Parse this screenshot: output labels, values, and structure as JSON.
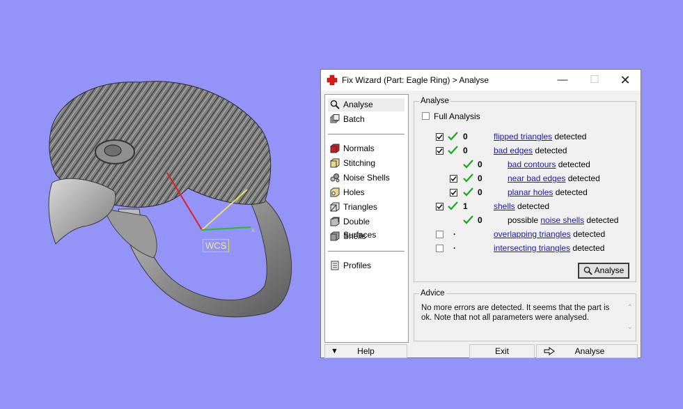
{
  "viewport": {
    "wcs_label": "WCS",
    "axis_x_label": "x",
    "background": "#9393f8"
  },
  "dialog": {
    "title": "Fix Wizard (Part: Eagle Ring) > Analyse",
    "title_icon": "red-cross-icon",
    "window_buttons": [
      "minimize",
      "maximize",
      "close"
    ]
  },
  "nav": {
    "top_items": [
      {
        "label": "Analyse",
        "icon": "magnifier-icon",
        "selected": true
      },
      {
        "label": "Batch",
        "icon": "batch-icon"
      }
    ],
    "tool_items": [
      {
        "label": "Normals",
        "icon": "normals-icon"
      },
      {
        "label": "Stitching",
        "icon": "stitching-icon"
      },
      {
        "label": "Noise Shells",
        "icon": "noise-shells-icon"
      },
      {
        "label": "Holes",
        "icon": "holes-icon"
      },
      {
        "label": "Triangles",
        "icon": "triangles-icon"
      },
      {
        "label": "Double Surfaces",
        "icon": "double-surfaces-icon"
      },
      {
        "label": "Shells",
        "icon": "shells-icon"
      }
    ],
    "bottom_items": [
      {
        "label": "Profiles",
        "icon": "profiles-icon"
      }
    ]
  },
  "analyse": {
    "group_title": "Analyse",
    "full_analysis_label": "Full Analysis",
    "full_analysis_checked": false,
    "rows": [
      {
        "checked": true,
        "ok": true,
        "value": "0",
        "link": "flipped triangles",
        "pre": "",
        "suffix": " detected"
      },
      {
        "checked": true,
        "ok": true,
        "value": "0",
        "link": "bad edges",
        "pre": "",
        "suffix": " detected"
      },
      {
        "checked": null,
        "ok": true,
        "value": "0",
        "link": "bad contours",
        "pre": "",
        "suffix": " detected"
      },
      {
        "checked": true,
        "ok": true,
        "value": "0",
        "link": "near bad edges",
        "pre": "",
        "suffix": " detected"
      },
      {
        "checked": true,
        "ok": true,
        "value": "0",
        "link": "planar holes",
        "pre": "",
        "suffix": " detected"
      },
      {
        "checked": true,
        "ok": true,
        "value": "1",
        "link": "shells",
        "pre": "",
        "suffix": " detected"
      },
      {
        "checked": null,
        "ok": true,
        "value": "0",
        "link": "noise shells",
        "pre": "possible ",
        "suffix": " detected"
      },
      {
        "checked": false,
        "ok": false,
        "value": ".",
        "link": "overlapping triangles",
        "pre": "",
        "suffix": " detected"
      },
      {
        "checked": false,
        "ok": false,
        "value": ".",
        "link": "intersecting triangles",
        "pre": "",
        "suffix": " detected"
      }
    ],
    "analyse_button": "Analyse"
  },
  "advice": {
    "group_title": "Advice",
    "text": "No more errors are detected. It seems that the part is ok. Note that not all parameters were analysed."
  },
  "bottom": {
    "help": "Help",
    "exit": "Exit",
    "analyse": "Analyse"
  },
  "colors": {
    "accent_link": "#1a1aa8",
    "ok_tick": "#1aa81a",
    "selected_bg": "#ececec"
  }
}
